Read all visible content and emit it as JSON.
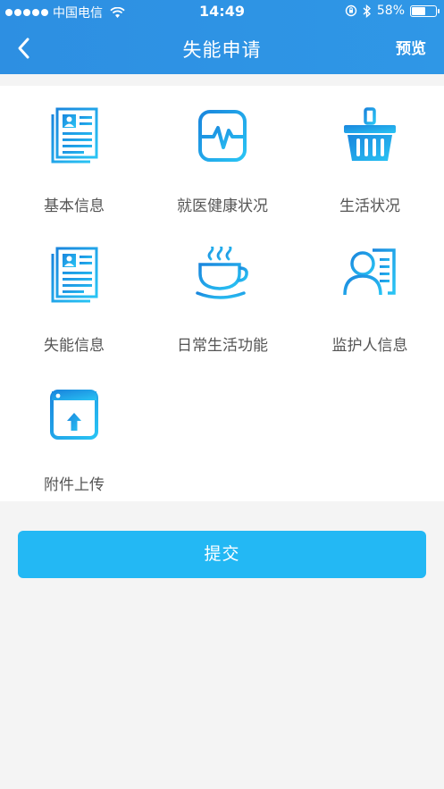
{
  "status_bar": {
    "carrier": "中国电信",
    "time": "14:49",
    "battery_text": "58%",
    "battery_level": 0.58
  },
  "nav": {
    "title": "失能申请",
    "preview_label": "预览",
    "back_icon": "chevron-left-icon"
  },
  "grid": {
    "items": [
      {
        "label": "基本信息",
        "icon": "document-card-icon"
      },
      {
        "label": "就医健康状况",
        "icon": "heartbeat-monitor-icon"
      },
      {
        "label": "生活状况",
        "icon": "basket-icon"
      },
      {
        "label": "失能信息",
        "icon": "document-card-icon"
      },
      {
        "label": "日常生活功能",
        "icon": "coffee-cup-icon"
      },
      {
        "label": "监护人信息",
        "icon": "guardian-profile-icon"
      },
      {
        "label": "附件上传",
        "icon": "upload-icon"
      }
    ]
  },
  "submit_label": "提交",
  "colors": {
    "header": "#2d8fe2",
    "icon_gradient_start": "#1a8fe0",
    "icon_gradient_end": "#27c3f2",
    "submit_button": "#23b8f4",
    "background": "#f4f4f4"
  }
}
